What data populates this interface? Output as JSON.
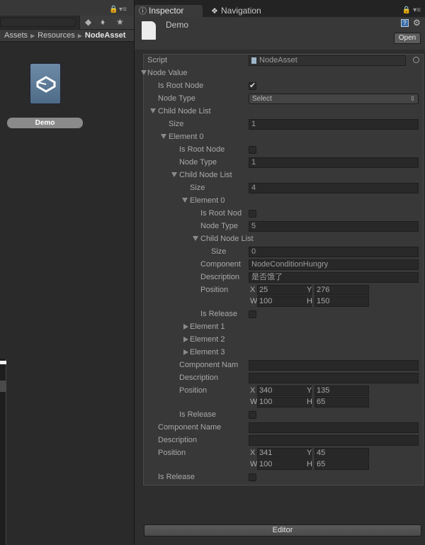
{
  "project": {
    "breadcrumb": [
      "Assets",
      "Resources",
      "NodeAsset"
    ],
    "asset_label": "Demo"
  },
  "inspector": {
    "tabs": [
      {
        "label": "Inspector",
        "icon": "info-icon"
      },
      {
        "label": "Navigation",
        "icon": "navigation-icon"
      }
    ],
    "title": "Demo",
    "open_label": "Open",
    "editor_label": "Editor",
    "script": {
      "label": "Script",
      "value": "NodeAsset"
    },
    "node_value": {
      "label": "Node Value",
      "is_root_label": "Is Root Node",
      "is_root": true,
      "node_type_label": "Node Type",
      "node_type_value": "Select",
      "child_list_label": "Child Node List",
      "size_label": "Size",
      "size": "1",
      "element0": {
        "label": "Element 0",
        "is_root_label": "Is Root Node",
        "is_root": false,
        "node_type_label": "Node Type",
        "node_type": "1",
        "child_list_label": "Child Node List",
        "size_label": "Size",
        "size": "4",
        "element0": {
          "label": "Element 0",
          "is_root_label": "Is Root Nod",
          "is_root": false,
          "node_type_label": "Node Type",
          "node_type": "5",
          "child_list_label": "Child Node List",
          "size_label": "Size",
          "size": "0",
          "component_label": "Component",
          "component": "NodeConditionHungry",
          "description_label": "Description",
          "description": "是否饿了",
          "position_label": "Position",
          "x": "25",
          "y": "276",
          "w": "100",
          "h": "150",
          "is_release_label": "Is Release",
          "is_release": false
        },
        "collapsed_elements": [
          "Element 1",
          "Element 2",
          "Element 3"
        ],
        "component_label": "Component Nam",
        "component": "",
        "description_label": "Description",
        "description": "",
        "position_label": "Position",
        "x": "340",
        "y": "135",
        "w": "100",
        "h": "65",
        "is_release_label": "Is Release",
        "is_release": false
      },
      "component_label": "Component Name",
      "component": "",
      "description_label": "Description",
      "description": "",
      "position_label": "Position",
      "x": "341",
      "y": "45",
      "w": "100",
      "h": "65",
      "is_release_label": "Is Release",
      "is_release": false
    },
    "rect_letters": {
      "x": "X",
      "y": "Y",
      "w": "W",
      "h": "H"
    }
  }
}
